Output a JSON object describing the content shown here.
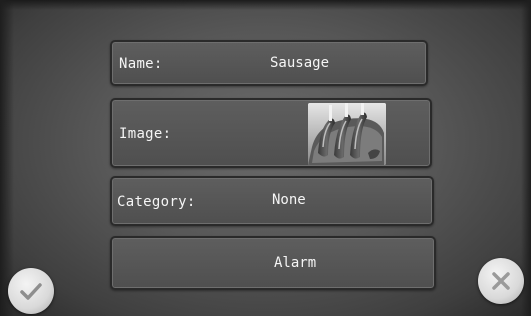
{
  "form": {
    "name": {
      "label": "Name:",
      "value": "Sausage"
    },
    "image": {
      "label": "Image:",
      "thumbnail_icon": "sausage-photo"
    },
    "category": {
      "label": "Category:",
      "value": "None"
    },
    "alarm": {
      "label": "Alarm"
    }
  },
  "actions": {
    "confirm_icon": "checkmark-icon",
    "cancel_icon": "close-icon"
  },
  "colors": {
    "panel": "#575757",
    "field_fill": "#5a5a5a",
    "field_border": "#2a2a2a",
    "text": "#f5f5f5",
    "button": "#e0e0e0",
    "icon": "#9a9a9a"
  }
}
